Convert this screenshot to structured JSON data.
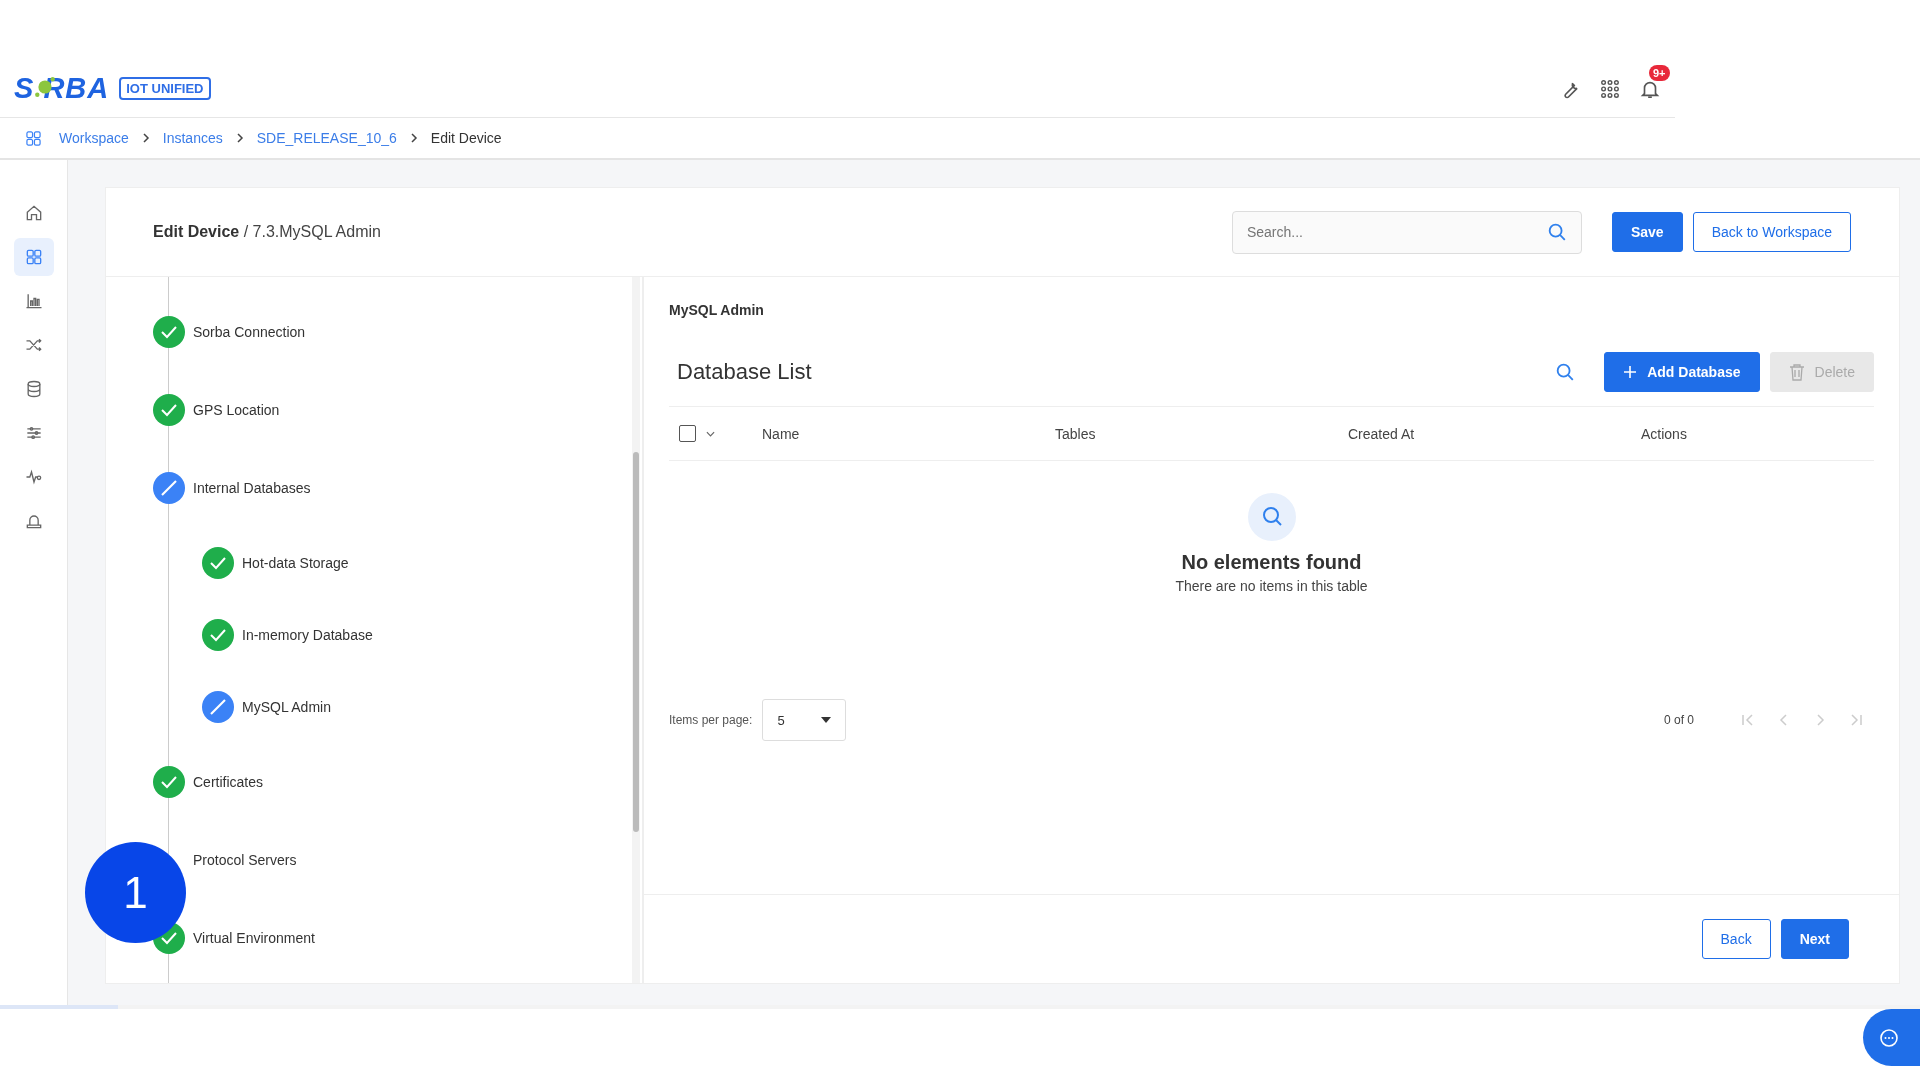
{
  "logo": {
    "brand": "S RBA",
    "badge": "IOT UNIFIED"
  },
  "notifications": {
    "badge": "9+"
  },
  "breadcrumb": [
    {
      "label": "Workspace",
      "link": true
    },
    {
      "label": "Instances",
      "link": true
    },
    {
      "label": "SDE_RELEASE_10_6",
      "link": true
    },
    {
      "label": "Edit Device",
      "link": false
    }
  ],
  "rail": [
    {
      "kind": "home",
      "selected": false
    },
    {
      "kind": "grid",
      "selected": true
    },
    {
      "kind": "chart",
      "selected": false
    },
    {
      "kind": "shuffle",
      "selected": false
    },
    {
      "kind": "database",
      "selected": false
    },
    {
      "kind": "sliders",
      "selected": false
    },
    {
      "kind": "pulse",
      "selected": false
    },
    {
      "kind": "alarm",
      "selected": false
    }
  ],
  "header": {
    "title": "Edit Device",
    "subtitle": " / 7.3.MySQL Admin",
    "search": {
      "placeholder": "Search..."
    },
    "buttons": [
      "Save",
      "Back to Workspace"
    ]
  },
  "steps": [
    {
      "label": "Sorba Connection",
      "kind": "done"
    },
    {
      "label": "GPS Location",
      "kind": "done"
    },
    {
      "label": "Internal Databases",
      "kind": "editing",
      "children": [
        {
          "label": "Hot-data Storage",
          "kind": "done"
        },
        {
          "label": "In-memory Database",
          "kind": "done"
        },
        {
          "label": "MySQL Admin",
          "kind": "editing"
        }
      ]
    },
    {
      "label": "Certificates",
      "kind": "done"
    },
    {
      "label": "Protocol Servers"
    },
    {
      "label": "Virtual Environment",
      "kind": "done"
    }
  ],
  "tutorial_marker": "1",
  "panel": {
    "section": "MySQL Admin",
    "title": "Database List",
    "add_button": "Add Database",
    "delete_button": {
      "label": "Delete",
      "disabled": true
    },
    "table": {
      "columns": [
        "Name",
        "Tables",
        "Created At",
        "Actions"
      ],
      "select_all": {
        "checked": false
      }
    },
    "empty": {
      "title": "No elements found",
      "text": "There are no items in this table"
    },
    "pagination": {
      "label": "Items per page:",
      "value": "5",
      "range": "0 of 0"
    },
    "footer_buttons": [
      "Back",
      "Next"
    ]
  }
}
